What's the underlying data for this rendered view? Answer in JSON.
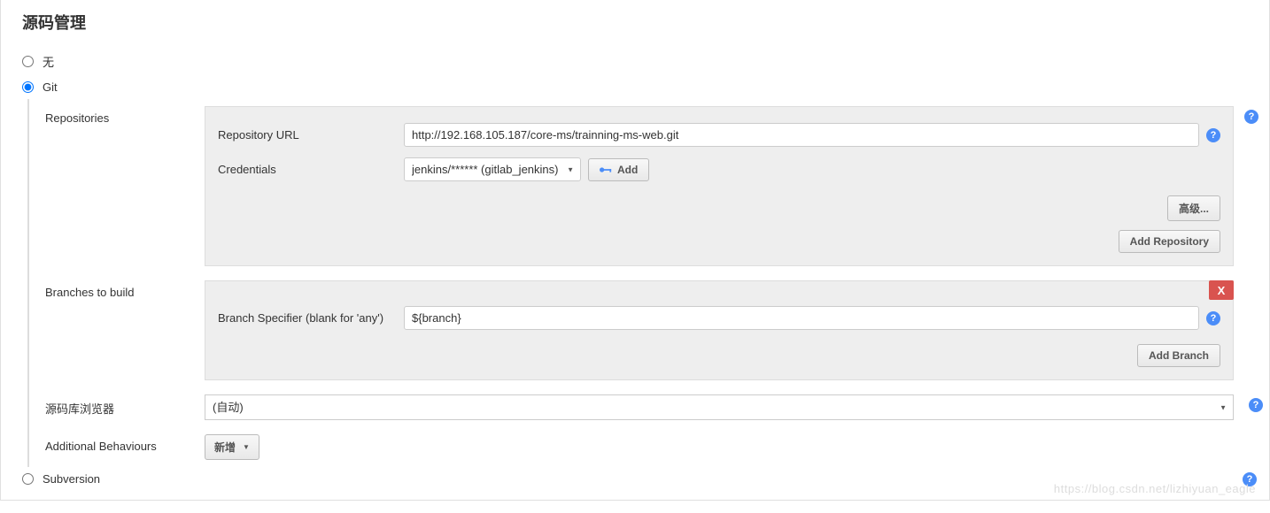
{
  "section_title": "源码管理",
  "scm_options": {
    "none": "无",
    "git": "Git",
    "subversion": "Subversion"
  },
  "repositories": {
    "label": "Repositories",
    "url_label": "Repository URL",
    "url_value": "http://192.168.105.187/core-ms/trainning-ms-web.git",
    "credentials_label": "Credentials",
    "credentials_value": "jenkins/****** (gitlab_jenkins)",
    "add_button": "Add",
    "advanced_button": "高级...",
    "add_repo_button": "Add Repository"
  },
  "branches": {
    "label": "Branches to build",
    "specifier_label": "Branch Specifier (blank for 'any')",
    "specifier_value": "${branch}",
    "add_branch_button": "Add Branch",
    "delete_label": "X"
  },
  "browser": {
    "label": "源码库浏览器",
    "value": "(自动)"
  },
  "behaviours": {
    "label": "Additional Behaviours",
    "add_button": "新增"
  },
  "watermark": "https://blog.csdn.net/lizhiyuan_eagle"
}
